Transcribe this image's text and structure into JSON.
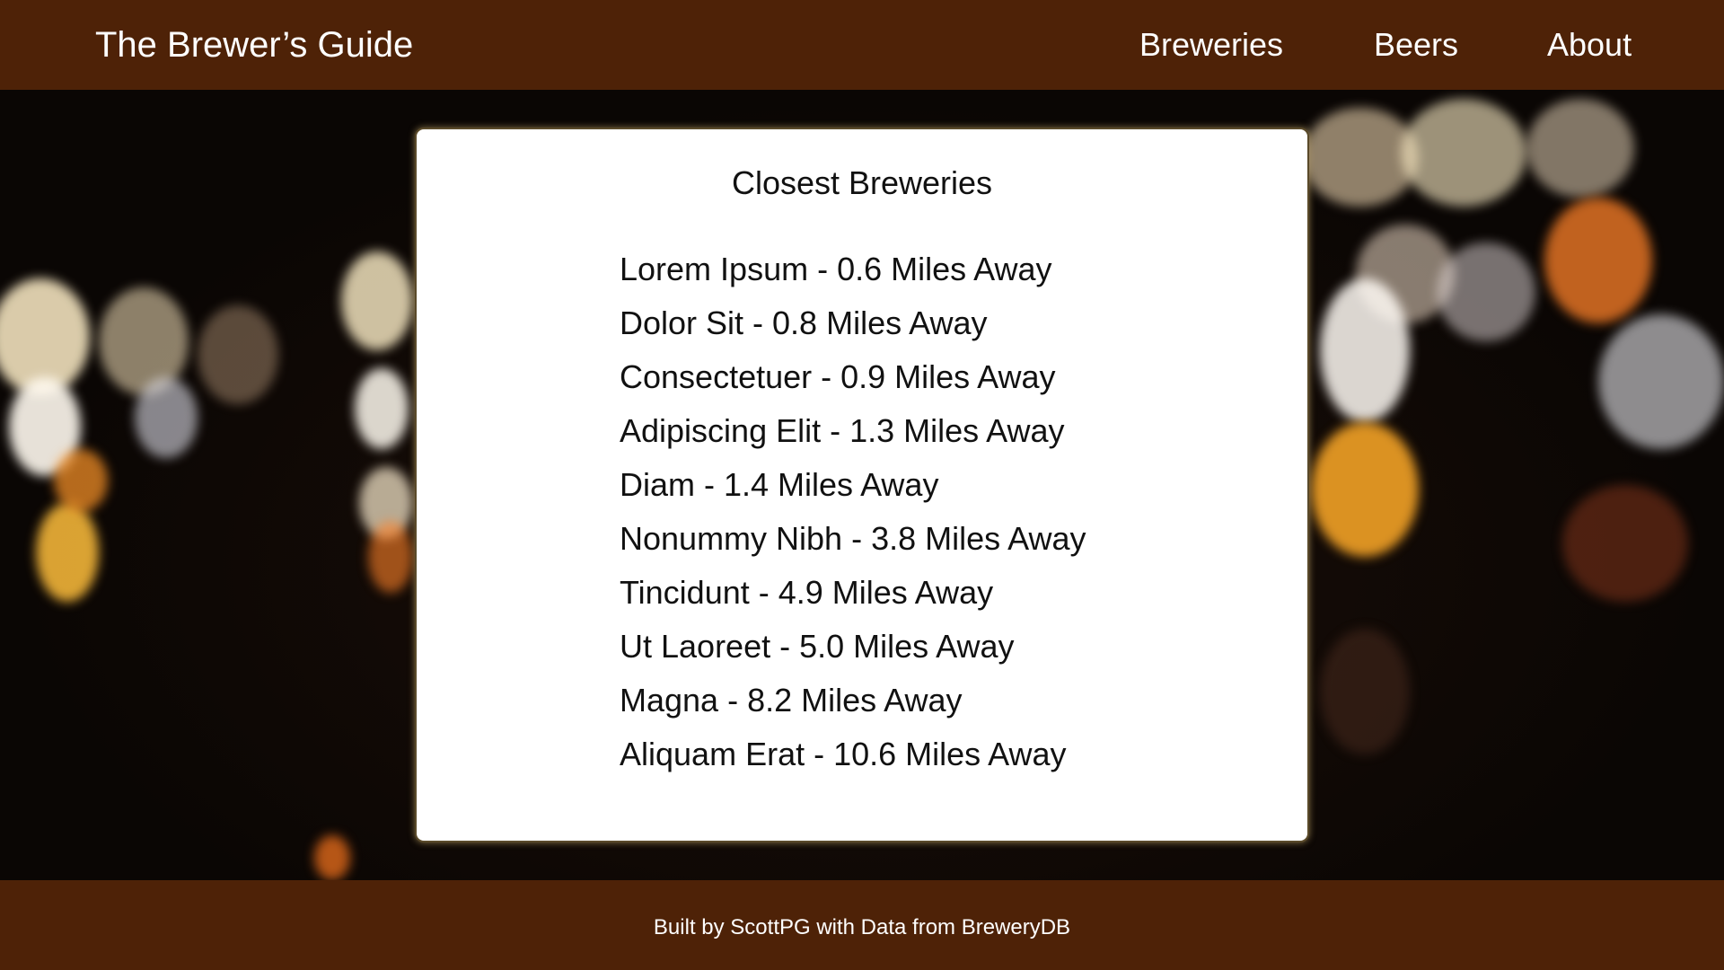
{
  "header": {
    "brand": "The Brewer’s Guide",
    "nav": [
      "Breweries",
      "Beers",
      "About"
    ]
  },
  "main": {
    "title": "Closest Breweries",
    "breweries": [
      "Lorem Ipsum - 0.6 Miles Away",
      "Dolor Sit - 0.8 Miles Away",
      "Consectetuer - 0.9 Miles Away",
      "Adipiscing Elit - 1.3 Miles Away",
      "Diam - 1.4 Miles Away",
      "Nonummy Nibh - 3.8 Miles Away",
      "Tincidunt - 4.9 Miles Away",
      "Ut Laoreet - 5.0 Miles Away",
      "Magna - 8.2 Miles Away",
      "Aliquam Erat - 10.6 Miles Away"
    ]
  },
  "footer": {
    "credit": "Built by ScottPG with Data from BreweryDB"
  },
  "colors": {
    "header_bg": "#4e2207",
    "footer_bg": "#4e2207",
    "panel_bg": "#ffffff",
    "text_light": "#ffffff",
    "text_dark": "#111111"
  }
}
